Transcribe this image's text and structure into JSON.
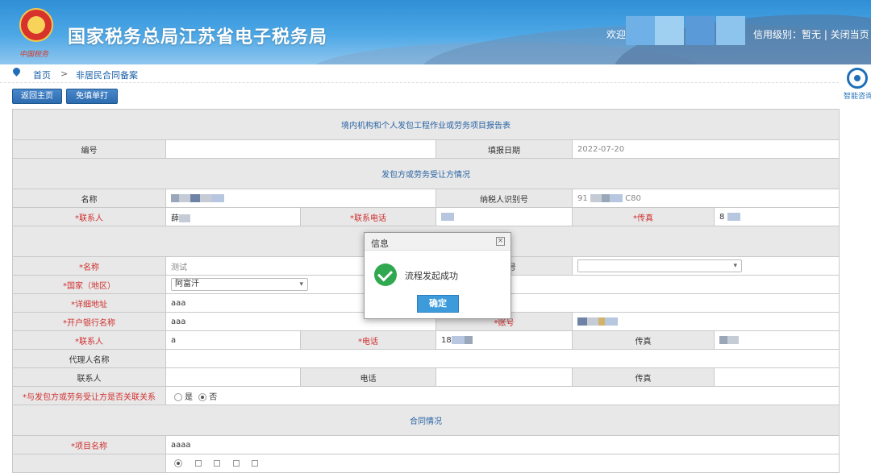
{
  "header": {
    "site_title": "国家税务总局江苏省电子税务局",
    "emblem_text": "中国税务",
    "welcome": "欢迎",
    "credit": "信用级别：暂无 | 关闭当页"
  },
  "assistant": {
    "label": "智能咨询"
  },
  "breadcrumb": {
    "home": "首页",
    "separator": ">",
    "current": "非居民合同备案"
  },
  "toolbar": {
    "home_button": "返回主页",
    "print_button": "免填单打印"
  },
  "form": {
    "title": "境内机构和个人发包工程作业或劳务项目报告表",
    "number_label": "编号",
    "fill_date_label": "填报日期",
    "fill_date_value": "2022-07-20",
    "section_contractor": "发包方或劳务受让方情况",
    "name_label": "名称",
    "taxpayer_id_label": "纳税人识别号",
    "taxpayer_id_prefix": "91",
    "taxpayer_id_suffix": "C80",
    "contact_label": "*联系人",
    "contact_value": "薛",
    "phone_label": "*联系电话",
    "fax_label": "*传真",
    "fax_value": "8",
    "section_contractee_partial": "承",
    "c_name_label": "*名称",
    "c_name_value": "测试",
    "c_id_label_partial": "识别号",
    "country_label": "*国家（地区）",
    "country_value": "阿富汗",
    "address_label": "*详细地址",
    "address_value": "aaa",
    "bank_label": "*开户银行名称",
    "bank_value": "aaa",
    "account_label": "*账号",
    "c_contact_label": "*联系人",
    "c_contact_value": "a",
    "c_phone_label": "*电话",
    "c_phone_value": "18",
    "c_fax_label": "传真",
    "agent_name_label": "代理人名称",
    "agent_contact_label": "联系人",
    "agent_phone_label": "电话",
    "agent_fax_label": "传真",
    "related_label": "*与发包方或劳务受让方是否关联关系",
    "related_yes": "是",
    "related_no": "否",
    "section_contract": "合同情况",
    "project_label": "*项目名称",
    "project_value": "aaaa"
  },
  "dialog": {
    "title": "信息",
    "close": "×",
    "message": "流程发起成功",
    "ok": "确定"
  }
}
